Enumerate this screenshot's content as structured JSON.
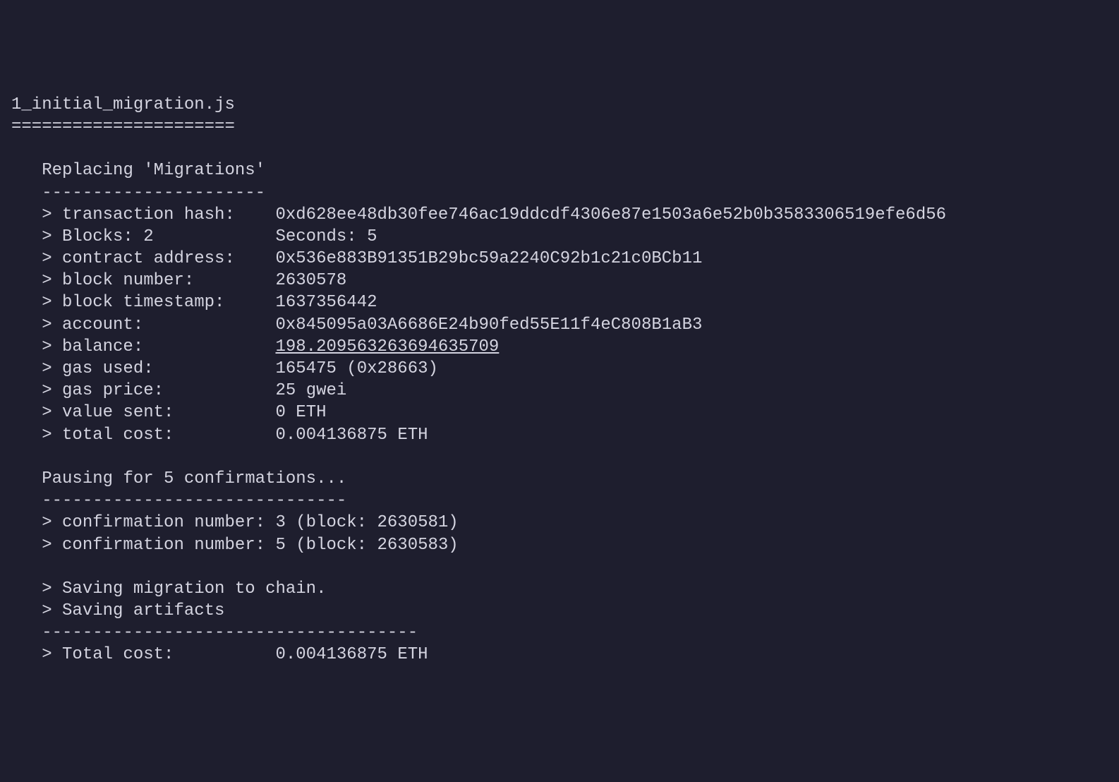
{
  "migration": {
    "filename": "1_initial_migration.js",
    "filename_underline": "======================",
    "action": "Replacing 'Migrations'",
    "action_underline": "----------------------",
    "transaction_hash_label": "transaction hash:",
    "transaction_hash": "0xd628ee48db30fee746ac19ddcdf4306e87e1503a6e52b0b3583306519efe6d56",
    "blocks_label": "Blocks: 2",
    "seconds_label": "Seconds: 5",
    "contract_address_label": "contract address:",
    "contract_address": "0x536e883B91351B29bc59a2240C92b1c21c0BCb11",
    "block_number_label": "block number:",
    "block_number": "2630578",
    "block_timestamp_label": "block timestamp:",
    "block_timestamp": "1637356442",
    "account_label": "account:",
    "account": "0x845095a03A6686E24b90fed55E11f4eC808B1aB3",
    "balance_label": "balance:",
    "balance": "198.209563263694635709",
    "gas_used_label": "gas used:",
    "gas_used": "165475 (0x28663)",
    "gas_price_label": "gas price:",
    "gas_price": "25 gwei",
    "value_sent_label": "value sent:",
    "value_sent": "0 ETH",
    "total_cost_label": "total cost:",
    "total_cost": "0.004136875 ETH",
    "pausing_message": "Pausing for 5 confirmations...",
    "pausing_underline": "------------------------------",
    "confirmation_1": "confirmation number: 3 (block: 2630581)",
    "confirmation_2": "confirmation number: 5 (block: 2630583)",
    "saving_migration": "Saving migration to chain.",
    "saving_artifacts": "Saving artifacts",
    "summary_underline": "-------------------------------------",
    "summary_total_cost_label": "Total cost:",
    "summary_total_cost": "0.004136875 ETH"
  }
}
